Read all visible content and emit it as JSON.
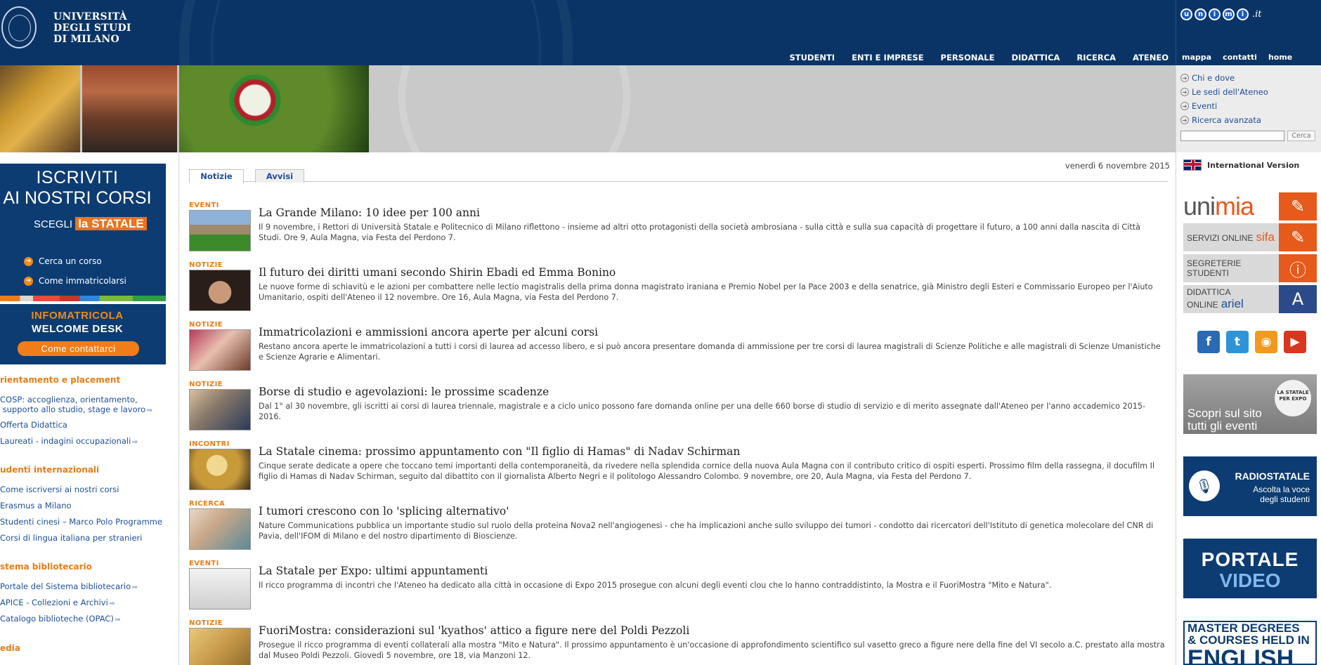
{
  "header": {
    "logo_line1": "UNIVERSITÀ",
    "logo_line2": "DEGLI STUDI",
    "logo_line3": "DI MILANO",
    "nav": [
      "STUDENTI",
      "ENTI E IMPRESE",
      "PERSONALE",
      "DIDATTICA",
      "RICERCA",
      "ATENEO"
    ],
    "brand_color": "#0a3466",
    "accent_color": "#e87d17"
  },
  "utility": {
    "unimi_letters": [
      "u",
      "n",
      "i",
      "m",
      "i"
    ],
    "unimi_suffix": ".it",
    "links": [
      "mappa",
      "contatti",
      "home"
    ]
  },
  "quick_links": [
    "Chi e dove",
    "Le sedi dell'Ateneo",
    "Eventi",
    "Ricerca avanzata"
  ],
  "search": {
    "button": "Cerca",
    "placeholder": ""
  },
  "left": {
    "iscriviti": {
      "line1": "ISCRIVITI",
      "line2": "AI NOSTRI CORSI",
      "scegli": "SCEGLI",
      "statale_la": "la",
      "statale": "STATALE",
      "btn1": "Cerca un corso",
      "btn2": "Come immatricolarsi"
    },
    "infomatricola": {
      "line1": "INFOMATRICOLA",
      "line2": "WELCOME DESK",
      "button": "Come contattarci"
    },
    "sections": [
      {
        "title": "rientamento e placement",
        "links": [
          "COSP: accoglienza, orientamento,",
          "supporto allo studio, stage e lavoro",
          "Offerta Didattica",
          "Laureati - indagini occupazionali"
        ]
      },
      {
        "title": "udenti internazionali",
        "links": [
          "Come iscriversi ai nostri corsi",
          "Erasmus a Milano",
          "Studenti cinesi – Marco Polo Programme",
          "Corsi di lingua italiana per stranieri"
        ]
      },
      {
        "title": "stema bibliotecario",
        "links": [
          "Portale del Sistema bibliotecario",
          "APICE - Collezioni e Archivi",
          "Catalogo biblioteche (OPAC)"
        ]
      },
      {
        "title": "edia",
        "links": []
      }
    ]
  },
  "main": {
    "date": "venerdì 6 novembre 2015",
    "tabs": [
      "Notizie",
      "Avvisi"
    ],
    "news": [
      {
        "category": "EVENTI",
        "title": "La Grande Milano: 10 idee per 100 anni",
        "desc": "Il 9 novembre, i Rettori di Università Statale e Politecnico di Milano riflettono - insieme ad altri otto protagonisti della società ambrosiana - sulla città e sulla sua capacità di progettare il futuro, a 100 anni dalla nascita di Città Studi. Ore 9, Aula Magna, via Festa del Perdono 7."
      },
      {
        "category": "NOTIZIE",
        "title": "Il futuro dei diritti umani secondo Shirin Ebadi ed Emma Bonino",
        "desc": "Le nuove forme di schiavitù e le azioni per combattere nelle lectio magistralis della prima donna magistrato iraniana e Premio Nobel per la Pace 2003 e della senatrice, già Ministro degli Esteri e Commissario Europeo per l'Aiuto Umanitario, ospiti dell'Ateneo il 12 novembre. Ore 16, Aula Magna, via Festa del Perdono 7."
      },
      {
        "category": "NOTIZIE",
        "title": "Immatricolazioni e ammissioni ancora aperte per alcuni corsi",
        "desc": "Restano ancora aperte le immatricolazioni a tutti i corsi di laurea ad accesso libero, e si può ancora presentare domanda di ammissione per tre corsi di laurea magistrali di Scienze Politiche e alle magistrali di Scienze Umanistiche e Scienze Agrarie e Alimentari."
      },
      {
        "category": "NOTIZIE",
        "title": "Borse di studio e agevolazioni: le prossime scadenze",
        "desc": "Dal 1° al 30 novembre, gli iscritti ai corsi di laurea triennale, magistrale e a ciclo unico possono fare domanda online per una delle 660 borse di studio di servizio e di merito assegnate dall'Ateneo per l'anno accademico 2015-2016."
      },
      {
        "category": "INCONTRI",
        "title": "La Statale cinema: prossimo appuntamento con \"Il figlio di Hamas\" di Nadav Schirman",
        "desc": "Cinque serate dedicate a opere che toccano temi importanti della contemporaneità, da rivedere nella splendida cornice della nuova Aula Magna con il contributo critico di ospiti esperti. Prossimo film della rassegna, il docufilm Il figlio di Hamas di Nadav Schirman, seguito dal dibattito con il giornalista Alberto Negri e il politologo Alessandro Colombo. 9 novembre, ore 20, Aula Magna, via Festa del Perdono 7."
      },
      {
        "category": "RICERCA",
        "title": "I tumori crescono con lo 'splicing alternativo'",
        "desc": "Nature Communications pubblica un importante studio sul ruolo della proteina Nova2 nell'angiogenesi - che ha implicazioni anche sullo sviluppo dei tumori - condotto dai ricercatori dell'Istituto di genetica molecolare del CNR di Pavia, dell'IFOM di Milano e del nostro dipartimento di Bioscienze."
      },
      {
        "category": "EVENTI",
        "title": "La Statale per Expo: ultimi appuntamenti",
        "desc": "Il ricco programma di incontri che l'Ateneo ha dedicato alla città in occasione di Expo 2015 prosegue con alcuni degli eventi clou che lo hanno contraddistinto, la Mostra e il FuoriMostra \"Mito e Natura\"."
      },
      {
        "category": "NOTIZIE",
        "title": "FuoriMostra: considerazioni sul 'kyathos' attico a figure nere del Poldi Pezzoli",
        "desc": "Prosegue il ricco programma di eventi collaterali alla mostra \"Mito e Natura\". Il prossimo appuntamento è un'occasione di approfondimento scientifico sul vasetto greco a figure nere della fine del VI secolo a.C. prestato alla mostra dal Museo Poldi Pezzoli. Giovedì 5 novembre, ore 18, via Manzoni 12."
      }
    ]
  },
  "right": {
    "international": "International Version",
    "services": [
      {
        "label_a": "uni",
        "label_b": "mia"
      },
      {
        "label": "SERVIZI ONLINE",
        "brand": "sifa"
      },
      {
        "label": "SEGRETERIE STUDENTI",
        "brand": ""
      },
      {
        "label": "DIDATTICA ONLINE",
        "brand": "ariel"
      }
    ],
    "socials": [
      "f",
      "t",
      "rss",
      "yt"
    ],
    "expo": {
      "text1": "Scopri sul sito",
      "text2": "tutti gli eventi",
      "badge": "LA STATALE PER EXPO"
    },
    "radio": {
      "title": "RADIOSTATALE",
      "line1": "Ascolta la voce",
      "line2": "degli studenti"
    },
    "video": {
      "line1": "PORTALE",
      "line2": "VIDEO"
    },
    "master": {
      "line1": "MASTER DEGREES",
      "line2": "& COURSES HELD IN",
      "big": "ENGLISH"
    }
  }
}
